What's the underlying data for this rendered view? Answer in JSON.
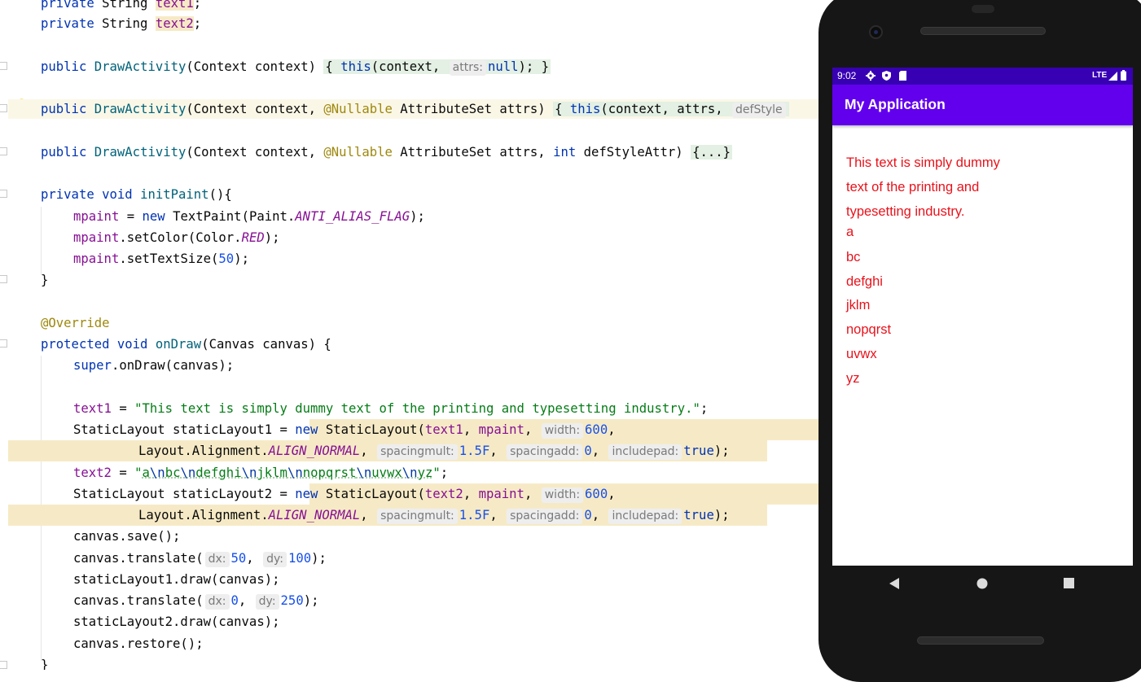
{
  "editor": {
    "lines": {
      "l1": "private String text1;",
      "l2": "private String text2;",
      "c1_a": "public",
      "c1_b": "DrawActivity",
      "c1_c": "(Context context) ",
      "c1_d": "{ ",
      "c1_e": "this",
      "c1_f": "(context, ",
      "c1_hint": "attrs:",
      "c1_g": "null",
      "c1_h": "); }",
      "c2_a": "public",
      "c2_b": "DrawActivity",
      "c2_c": "(Context context, ",
      "c2_d": "@Nullable",
      "c2_e": " AttributeSet attrs) ",
      "c2_f": "{ ",
      "c2_g": "this",
      "c2_h": "(context, attrs, ",
      "c2_hint": "defStyle",
      "c3_a": "public",
      "c3_b": "DrawActivity",
      "c3_c": "(Context context, ",
      "c3_d": "@Nullable",
      "c3_e": " AttributeSet attrs, ",
      "c3_f": "int",
      "c3_g": " defStyleAttr) ",
      "c3_h": "{...}",
      "ip_a": "private",
      "ip_b": "void",
      "ip_c": "initPaint",
      "ip_d": "(){",
      "m1_a": "mpaint",
      "m1_b": " = ",
      "m1_c": "new",
      "m1_d": " TextPaint(Paint.",
      "m1_e": "ANTI_ALIAS_FLAG",
      "m1_f": ");",
      "m2_a": "mpaint",
      "m2_b": ".setColor(Color.",
      "m2_c": "RED",
      "m2_d": ");",
      "m3_a": "mpaint",
      "m3_b": ".setTextSize(",
      "m3_c": "50",
      "m3_d": ");",
      "brace": "}",
      "override": "@Override",
      "od_a": "protected",
      "od_b": "void",
      "od_c": "onDraw",
      "od_d": "(Canvas canvas) {",
      "sup_a": "super",
      "sup_b": ".onDraw(canvas);",
      "t1_a": "text1",
      "t1_b": " = ",
      "t1_c": "\"This text is simply dummy text of the printing and typesetting industry.\"",
      "t1_d": ";",
      "s1_a": "StaticLayout staticLayout1 = ",
      "s1_b": "new",
      "s1_c": " StaticLayout(",
      "s1_d": "text1",
      "s1_e": ", ",
      "s1_f": "mpaint",
      "s1_g": ", ",
      "s1_hint": "width:",
      "s1_h": "600",
      "s1_i": ",",
      "la_a": "Layout.Alignment.",
      "la_b": "ALIGN_NORMAL",
      "la_c": ", ",
      "la_hint1": "spacingmult:",
      "la_d": "1.5F",
      "la_e": ", ",
      "la_hint2": "spacingadd:",
      "la_f": "0",
      "la_g": ", ",
      "la_hint3": "includepad:",
      "la_h": "true",
      "la_i": ");",
      "t2_a": "text2",
      "t2_b": " = ",
      "t2_q": "\"",
      "t2_parts": [
        "a",
        "\\n",
        "bc",
        "\\n",
        "defghi",
        "\\n",
        "jklm",
        "\\n",
        "nopqrst",
        "\\n",
        "uvwx",
        "\\n",
        "yz"
      ],
      "t2_d": ";",
      "s2_a": "StaticLayout staticLayout2 = ",
      "s2_b": "new",
      "s2_c": " StaticLayout(",
      "s2_d": "text2",
      "s2_e": ", ",
      "s2_f": "mpaint",
      "s2_g": ", ",
      "s2_hint": "width:",
      "s2_h": "600",
      "s2_i": ",",
      "save": "canvas.save();",
      "tr1_a": "canvas.translate(",
      "tr1_hint1": "dx:",
      "tr1_b": "50",
      "tr1_c": ", ",
      "tr1_hint2": "dy:",
      "tr1_d": "100",
      "tr1_e": ");",
      "draw1": "staticLayout1.draw(canvas);",
      "tr2_a": "canvas.translate(",
      "tr2_hint1": "dx:",
      "tr2_b": "0",
      "tr2_c": ", ",
      "tr2_hint2": "dy:",
      "tr2_d": "250",
      "tr2_e": ");",
      "draw2": "staticLayout2.draw(canvas);",
      "restore": "canvas.restore();",
      "close": "}"
    }
  },
  "phone": {
    "status": {
      "time": "9:02",
      "network": "LTE"
    },
    "app_title": "My Application",
    "text1_lines": [
      "This text is simply dummy",
      "text of the printing and",
      "typesetting industry."
    ],
    "text2_lines": [
      "a",
      "bc",
      "defghi",
      "jklm",
      "nopqrst",
      "uvwx",
      "yz"
    ]
  },
  "colors": {
    "accent": "#6200ee",
    "status_bar": "#3700b3",
    "text_red": "#e8121b"
  }
}
